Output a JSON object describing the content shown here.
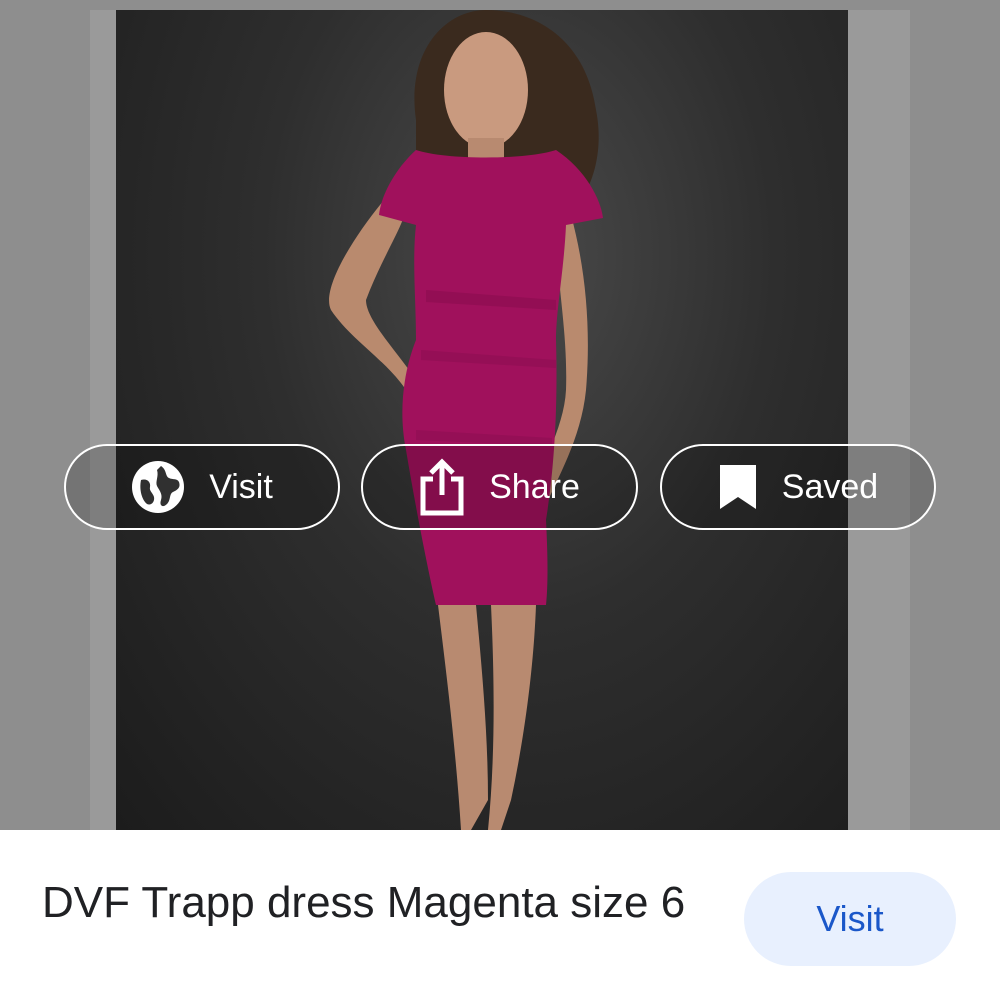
{
  "actions": {
    "visit": {
      "label": "Visit",
      "icon": "globe-icon"
    },
    "share": {
      "label": "Share",
      "icon": "share-icon"
    },
    "saved": {
      "label": "Saved",
      "icon": "bookmark-icon"
    }
  },
  "result": {
    "title": "DVF Trapp dress Magenta size 6",
    "visit_label": "Visit"
  },
  "colors": {
    "accent": "#1a57c9",
    "pill_bg": "#e8f0fe",
    "dress": "#a0115c"
  }
}
